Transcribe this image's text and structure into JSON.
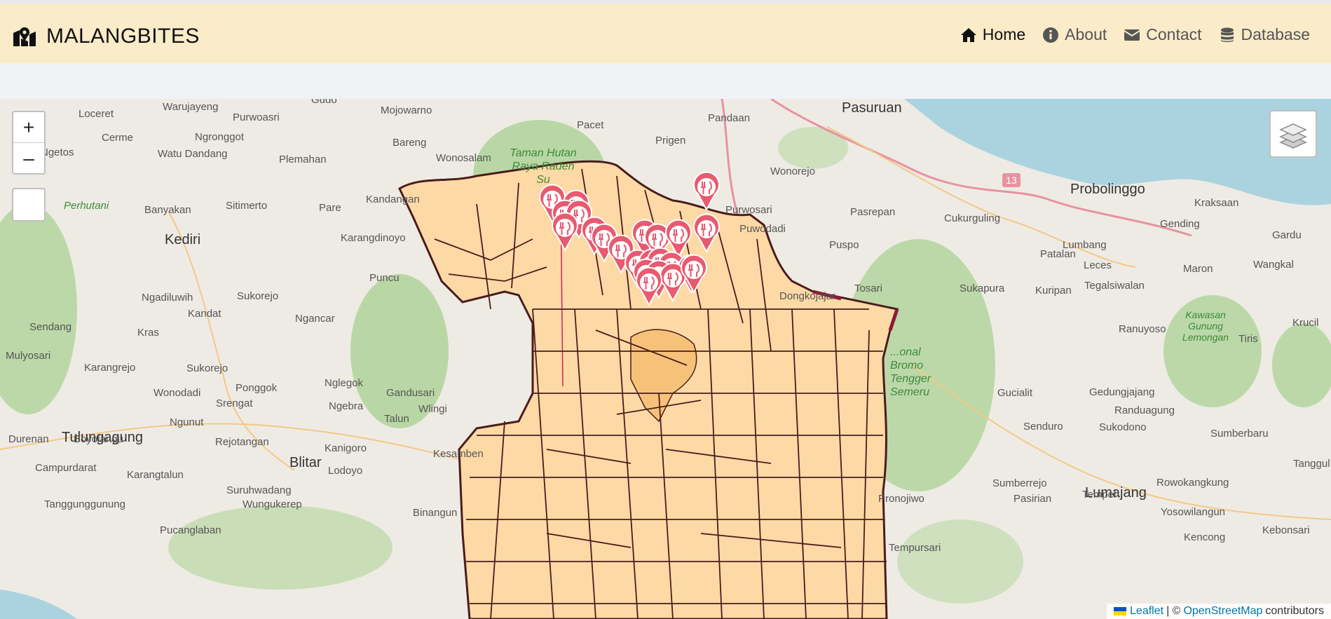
{
  "navbar": {
    "brand": "MALANGBITES",
    "links": [
      {
        "label": "Home",
        "icon": "home-icon"
      },
      {
        "label": "About",
        "icon": "info-icon"
      },
      {
        "label": "Contact",
        "icon": "envelope-icon"
      },
      {
        "label": "Database",
        "icon": "database-icon"
      }
    ]
  },
  "map": {
    "zoom_in": "+",
    "zoom_out": "–",
    "attribution": {
      "leaflet": "Leaflet",
      "separator": "| ©",
      "osm": "OpenStreetMap",
      "suffix": "contributors"
    },
    "labels": {
      "pasuruan": "Pasuruan",
      "probolinggo": "Probolinggo",
      "kediri": "Kediri",
      "tulungagung": "Tulungagung",
      "blitar": "Blitar",
      "lumajang": "Lumajang",
      "loceret": "Loceret",
      "warujayeng": "Warujayeng",
      "purwoasri": "Purwoasri",
      "mojowarno": "Mojowarno",
      "pacet": "Pacet",
      "pandaan": "Pandaan",
      "cerme": "Cerme",
      "ngronggot": "Ngronggot",
      "watu_dandang": "Watu Dandang",
      "plemahan": "Plemahan",
      "bareng": "Bareng",
      "wonosalam": "Wonosalam",
      "prigen": "Prigen",
      "ngetos": "Ngetos",
      "wonorejo": "Wonorejo",
      "banyakan": "Banyakan",
      "sitimerto": "Sitimerto",
      "pare": "Pare",
      "kandangan": "Kandangan",
      "purwosari": "Purwosari",
      "pasrepan": "Pasrepan",
      "cukurguling": "Cukurguling",
      "kraksaan": "Kraksaan",
      "gending": "Gending",
      "puwodadi": "Puwodadi",
      "karangdinoyo": "Karangdinoyo",
      "lumbang": "Lumbang",
      "patalan": "Patalan",
      "leces": "Leces",
      "gardu": "Gardu",
      "puspo": "Puspo",
      "maron": "Maron",
      "wangkal": "Wangkal",
      "puncu": "Puncu",
      "tegalsiwalan": "Tegalsiwalan",
      "dongkojajar": "Dongkojajar",
      "tosari": "Tosari",
      "sukapura": "Sukapura",
      "kuripan": "Kuripan",
      "ngadiluwih": "Ngadiluwih",
      "sukorejo": "Sukorejo",
      "kandat": "Kandat",
      "ngancar": "Ngancar",
      "sendang": "Sendang",
      "kras": "Kras",
      "ranuyoso": "Ranuyoso",
      "krucil": "Krucil",
      "tiris": "Tiris",
      "mulyosari": "Mulyosari",
      "karangrejo": "Karangrejo",
      "sukorejo2": "Sukorejo",
      "wonodadi": "Wonodadi",
      "ponggok": "Ponggok",
      "nglegok": "Nglegok",
      "gandusari": "Gandusari",
      "gucialit": "Gucialit",
      "gedungjajang": "Gedungjajang",
      "srengat": "Srengat",
      "ngebra": "Ngebra",
      "wlingi": "Wlingi",
      "randuagung": "Randuagung",
      "ngunut": "Ngunut",
      "talun": "Talun",
      "senduro": "Senduro",
      "sukodono": "Sukodono",
      "sumberbaru": "Sumberbaru",
      "durenan": "Durenan",
      "boyolangu": "Boyolangu",
      "rejotangan": "Rejotangan",
      "kanigoro": "Kanigoro",
      "campurdarat": "Campurdarat",
      "karangtalun": "Karangtalun",
      "lodoyo": "Lodoyo",
      "kesamben": "Kesamben",
      "tanggul": "Tanggul",
      "suruhwadang": "Suruhwadang",
      "sumberrejo": "Sumberrejo",
      "rowokangkung": "Rowokangkung",
      "tanggunggunung": "Tanggunggunung",
      "wungukerep": "Wungukerep",
      "pasirian": "Pasirian",
      "tempeh": "Tempeh",
      "pronojiwo": "Pronojiwo",
      "yosowilangun": "Yosowilangun",
      "pucanglaban": "Pucanglaban",
      "binangun": "Binangun",
      "kencong": "Kencong",
      "kebonsari": "Kebonsari",
      "tempursari": "Tempursari",
      "gudo": "Gudo",
      "route13": "13",
      "taman_hutan_raya": "Taman Hutan Raya Raden Su",
      "perhutani": "Perhutani",
      "bromo": "...onal Bromo Tengger Semeru",
      "kawasan_lemongan": "Kawasan Gunung Lemongan"
    }
  },
  "markers": [
    {
      "name": "restaurant-marker",
      "icon": "fork-knife-icon",
      "color": "#e85a6f"
    }
  ],
  "colors": {
    "navbar_bg": "#faebc9",
    "region_fill": "#fdd9a5",
    "region_stroke": "#4a1c1c",
    "marker": "#e85a6f",
    "water": "#aad3df",
    "forest": "#8bc17a"
  }
}
